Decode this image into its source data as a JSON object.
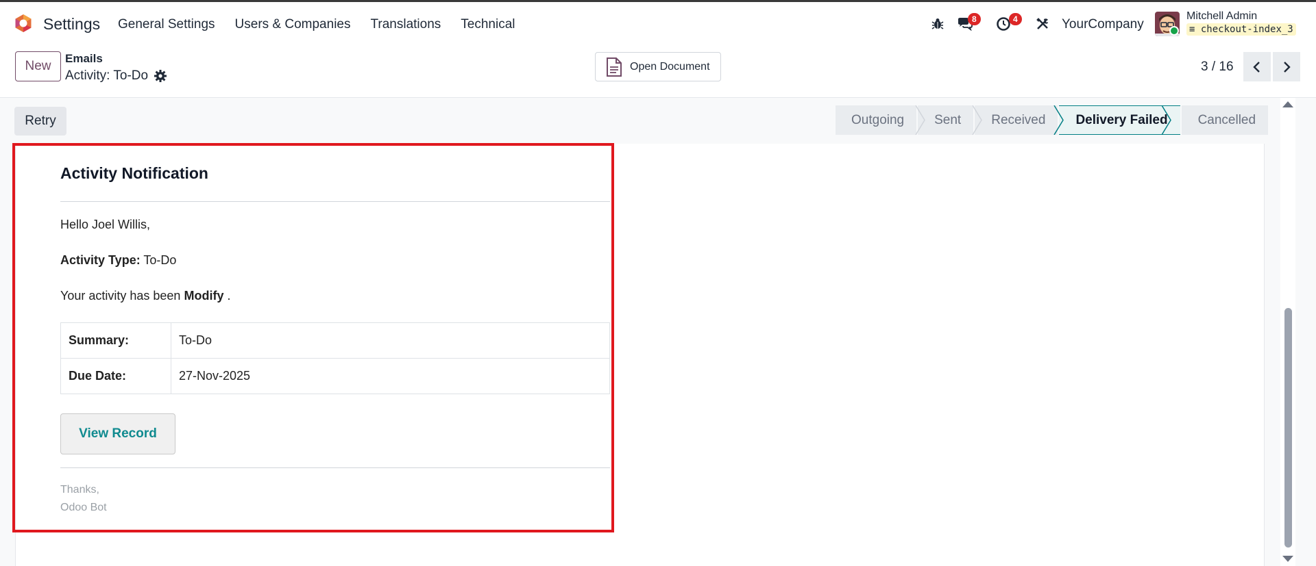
{
  "navbar": {
    "app_name": "Settings",
    "menu": [
      "General Settings",
      "Users & Companies",
      "Translations",
      "Technical"
    ],
    "messages_count": "8",
    "activities_count": "4",
    "company": "YourCompany",
    "user_name": "Mitchell Admin",
    "database": "checkout-index_3"
  },
  "control": {
    "new_label": "New",
    "breadcrumb_parent": "Emails",
    "breadcrumb_current": "Activity: To-Do",
    "open_document_label": "Open Document",
    "pager": "3 / 16"
  },
  "statusbar": {
    "retry_label": "Retry",
    "stages": [
      "Outgoing",
      "Sent",
      "Received",
      "Delivery Failed",
      "Cancelled"
    ],
    "active_stage": "Delivery Failed"
  },
  "email": {
    "title": "Activity Notification",
    "greeting": "Hello Joel Willis,",
    "activity_type_label": "Activity Type:",
    "activity_type_value": "To-Do",
    "status_prefix": "Your activity has been",
    "status_value": "Modify",
    "status_suffix": ".",
    "rows": [
      {
        "label": "Summary:",
        "value": "To-Do"
      },
      {
        "label": "Due Date:",
        "value": "27-Nov-2025"
      }
    ],
    "button_label": "View Record",
    "sign_1": "Thanks,",
    "sign_2": "Odoo Bot"
  },
  "colors": {
    "brand": "#714b67",
    "accent": "#017e84",
    "highlight": "#e0181e",
    "badge": "#dc2626"
  }
}
